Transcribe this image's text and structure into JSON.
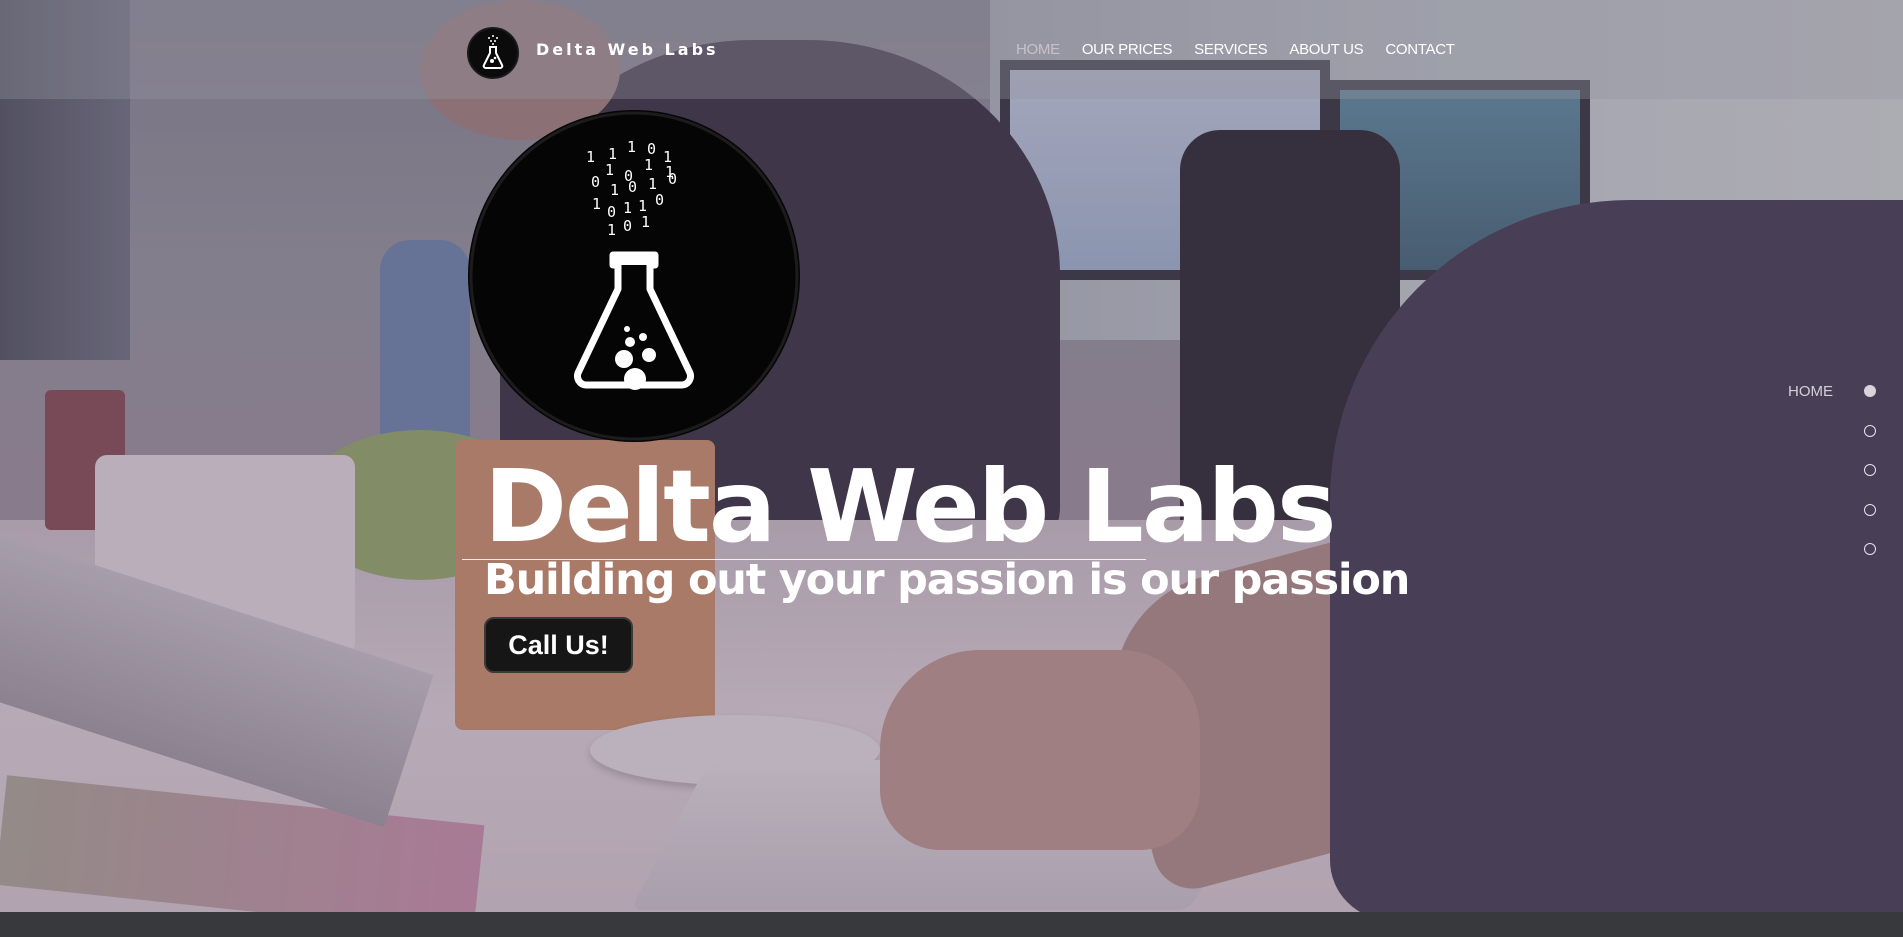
{
  "header": {
    "brand": "Delta Web Labs",
    "nav": [
      {
        "label": "HOME",
        "active": true
      },
      {
        "label": "OUR PRICES",
        "active": false
      },
      {
        "label": "SERVICES",
        "active": false
      },
      {
        "label": "ABOUT US",
        "active": false
      },
      {
        "label": "CONTACT",
        "active": false
      }
    ]
  },
  "hero": {
    "title": "Delta Web Labs",
    "subtitle": "Building out your passion is our passion",
    "cta_label": "Call Us!",
    "logo_icon": "flask-binary-logo",
    "logo_digits": [
      "1",
      "1",
      "0",
      "1",
      "1",
      "1",
      "0",
      "1",
      "1",
      "0",
      "1",
      "0",
      "1",
      "0",
      "1",
      "0",
      "1",
      "1",
      "0",
      "1",
      "0",
      "1"
    ]
  },
  "side_nav": {
    "active_label": "HOME",
    "dot_count": 5
  },
  "colors": {
    "overlay": "#5c4660",
    "button_bg": "#161616",
    "text": "#ffffff",
    "nav_active": "#c7c1cc",
    "bottom_band": "#38393d"
  }
}
